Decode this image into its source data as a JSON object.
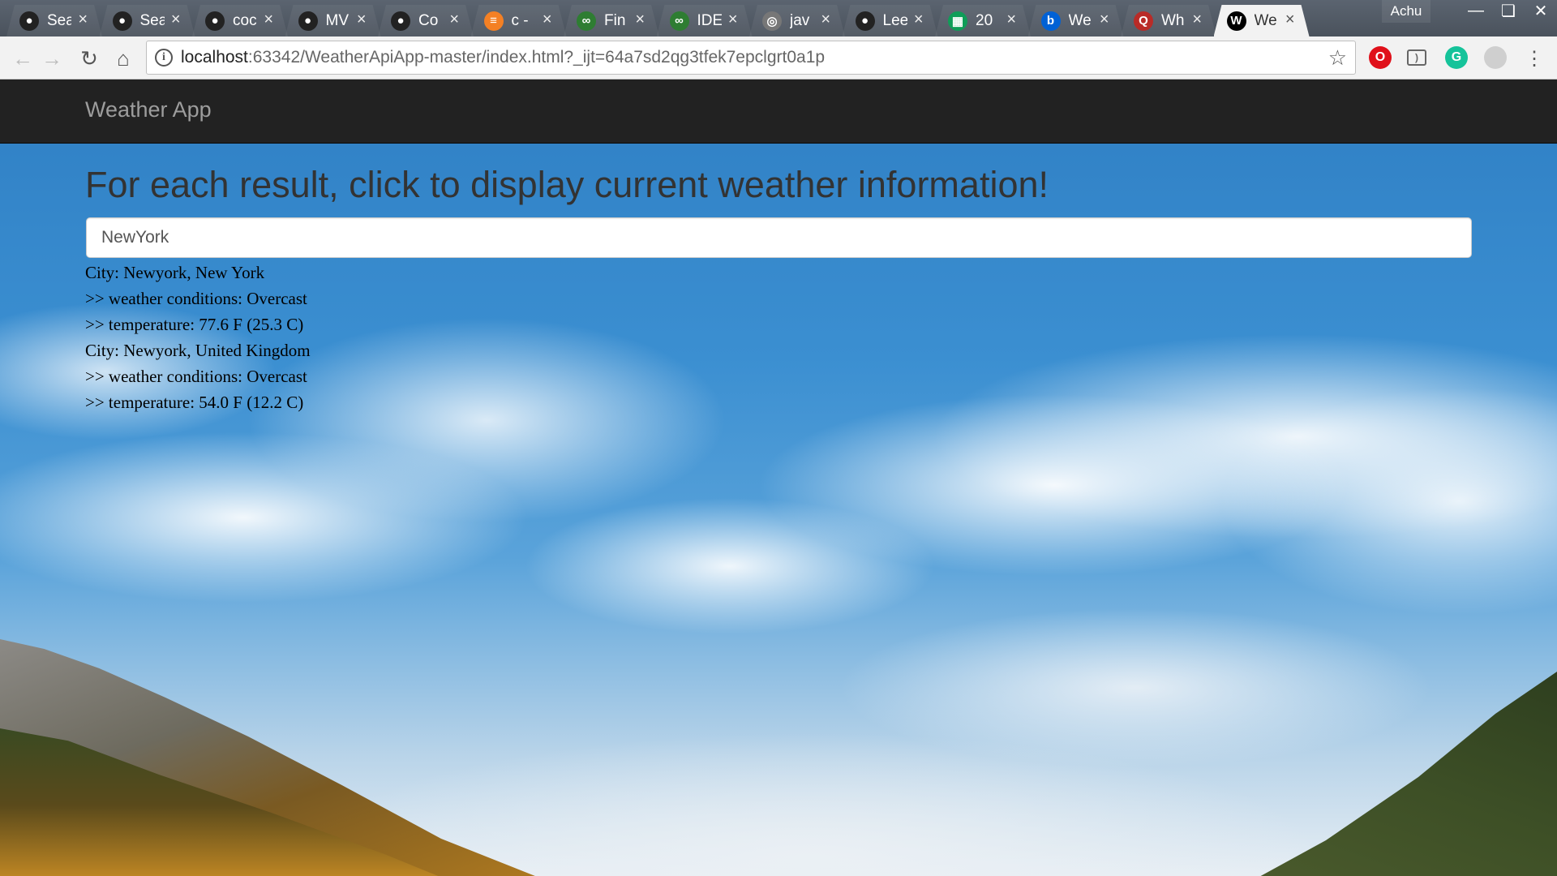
{
  "browser": {
    "profile_name": "Achu",
    "tabs": [
      {
        "title": "Sea",
        "icon": "github-icon",
        "color": "#222222"
      },
      {
        "title": "Sea",
        "icon": "github-icon",
        "color": "#222222"
      },
      {
        "title": "coc",
        "icon": "github-icon",
        "color": "#222222"
      },
      {
        "title": "MV",
        "icon": "github-icon",
        "color": "#222222"
      },
      {
        "title": "Co",
        "icon": "github-icon",
        "color": "#222222"
      },
      {
        "title": "c -",
        "icon": "stackoverflow-icon",
        "color": "#f48024"
      },
      {
        "title": "Fin",
        "icon": "app-icon",
        "color": "#2e7d32"
      },
      {
        "title": "IDE",
        "icon": "app-icon",
        "color": "#2e7d32"
      },
      {
        "title": "jav",
        "icon": "globe-icon",
        "color": "#777777"
      },
      {
        "title": "Lee",
        "icon": "github-icon",
        "color": "#222222"
      },
      {
        "title": "20",
        "icon": "sheets-icon",
        "color": "#0f9d58"
      },
      {
        "title": "We",
        "icon": "box-icon",
        "color": "#0061d5"
      },
      {
        "title": "Wh",
        "icon": "quora-icon",
        "color": "#b92b27"
      },
      {
        "title": "We",
        "icon": "webstorm-icon",
        "color": "#000000"
      }
    ],
    "url_host": "localhost",
    "url_rest": ":63342/WeatherApiApp-master/index.html?_ijt=64a7sd2qg3tfek7epclgrt0a1p",
    "icons": {
      "back": "back-arrow-icon",
      "forward": "forward-arrow-icon",
      "reload": "reload-icon",
      "home": "home-icon",
      "info": "info-icon",
      "bookmark": "star-icon",
      "menu": "menu-icon"
    }
  },
  "page": {
    "brand": "Weather App",
    "heading": "For each result, click to display current weather information!",
    "search_value": "NewYork",
    "results": [
      {
        "city": "City: Newyork, New York",
        "conditions": ">> weather conditions: Overcast",
        "temperature": ">> temperature: 77.6 F (25.3 C)"
      },
      {
        "city": "City: Newyork, United Kingdom",
        "conditions": ">> weather conditions: Overcast",
        "temperature": ">> temperature: 54.0 F (12.2 C)"
      }
    ]
  },
  "colors": {
    "navbar_bg": "#222222",
    "brand_text": "#9d9d9d",
    "heading_text": "#333333"
  }
}
